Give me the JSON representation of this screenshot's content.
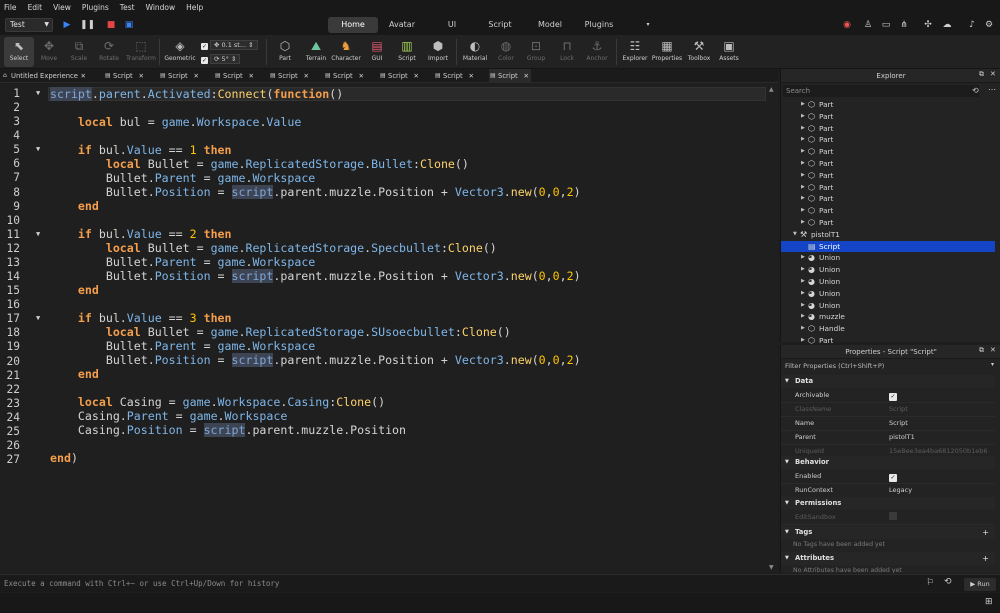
{
  "menu": [
    "File",
    "Edit",
    "View",
    "Plugins",
    "Test",
    "Window",
    "Help"
  ],
  "toolbar": {
    "place_select": "Test",
    "ribbon_tabs": [
      "Home",
      "Avatar",
      "UI",
      "Script",
      "Model",
      "Plugins"
    ],
    "active_tab": "Home",
    "tools": {
      "select": "Select",
      "move": "Move",
      "scale": "Scale",
      "rotate": "Rotate",
      "transform": "Transform",
      "geometric": "Geometric",
      "snap_move": "0.1 st...",
      "snap_rotate": "5°",
      "part": "Part",
      "terrain": "Terrain",
      "character": "Character",
      "gui": "GUI",
      "script": "Script",
      "import": "Import",
      "material": "Material",
      "color": "Color",
      "group": "Group",
      "lock": "Lock",
      "anchor": "Anchor",
      "explorer": "Explorer",
      "properties": "Properties",
      "toolbox": "Toolbox",
      "assets": "Assets"
    }
  },
  "doc_tabs": [
    "Untitled Experience",
    "Script",
    "Script",
    "Script",
    "Script",
    "Script",
    "Script",
    "Script",
    "Script"
  ],
  "editor": {
    "line_numbers": [
      "1",
      "2",
      "3",
      "4",
      "5",
      "6",
      "7",
      "8",
      "9",
      "10",
      "11",
      "12",
      "13",
      "14",
      "15",
      "16",
      "17",
      "18",
      "19",
      "20",
      "21",
      "22",
      "23",
      "24",
      "25",
      "26",
      "27"
    ]
  },
  "command_bar": {
    "placeholder": "Execute a command with Ctrl+~ or use Ctrl+Up/Down for history",
    "run": "Run"
  },
  "explorer": {
    "title": "Explorer",
    "search_placeholder": "Search",
    "items": [
      {
        "label": "Part",
        "icon": "part-icon"
      },
      {
        "label": "Part",
        "icon": "part-icon"
      },
      {
        "label": "Part",
        "icon": "part-icon"
      },
      {
        "label": "Part",
        "icon": "part-icon"
      },
      {
        "label": "Part",
        "icon": "part-icon"
      },
      {
        "label": "Part",
        "icon": "part-icon"
      },
      {
        "label": "Part",
        "icon": "part-icon"
      },
      {
        "label": "Part",
        "icon": "part-icon"
      },
      {
        "label": "Part",
        "icon": "part-icon"
      },
      {
        "label": "Part",
        "icon": "part-icon"
      },
      {
        "label": "Part",
        "icon": "part-icon"
      },
      {
        "label": "pistolT1",
        "icon": "tool-icon"
      },
      {
        "label": "Script",
        "icon": "script-icon"
      },
      {
        "label": "Union",
        "icon": "union-icon"
      },
      {
        "label": "Union",
        "icon": "union-icon"
      },
      {
        "label": "Union",
        "icon": "union-icon"
      },
      {
        "label": "Union",
        "icon": "union-icon"
      },
      {
        "label": "Union",
        "icon": "union-icon"
      },
      {
        "label": "muzzle",
        "icon": "union-icon"
      },
      {
        "label": "Handle",
        "icon": "part-icon"
      },
      {
        "label": "Part",
        "icon": "part-icon"
      }
    ]
  },
  "properties": {
    "title": "Properties - Script \"Script\"",
    "filter": "Filter Properties (Ctrl+Shift+P)",
    "data_label": "Data",
    "archivable": "Archivable",
    "classname": "ClassName",
    "classname_val": "Script",
    "name": "Name",
    "name_val": "Script",
    "parent": "Parent",
    "parent_val": "pistolT1",
    "uniqueid": "UniqueId",
    "uniqueid_val": "15eBee3ea4ba6812050b1eb6",
    "behavior_label": "Behavior",
    "enabled": "Enabled",
    "runcontext": "RunContext",
    "runcontext_val": "Legacy",
    "permissions_label": "Permissions",
    "editsandbox": "EditSandbox",
    "tags_label": "Tags",
    "tags_note": "No Tags have been added yet",
    "attributes_label": "Attributes",
    "attributes_note": "No Attributes have been added yet"
  },
  "colors": {
    "selection": "#1345c6",
    "keyword": "#f59e4c",
    "number": "#ffc600",
    "property": "#7fb6e8"
  }
}
